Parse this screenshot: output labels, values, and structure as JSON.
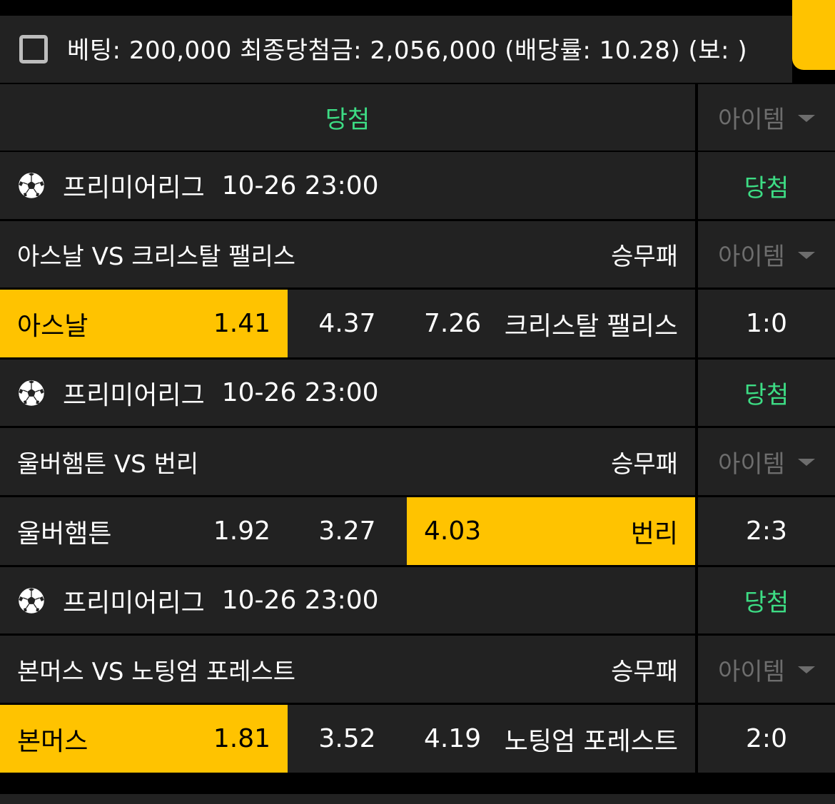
{
  "summary": {
    "text": "베팅: 200,000 최종당첨금: 2,056,000 (배당률: 10.28) (보: )"
  },
  "header": {
    "status": "당첨",
    "item_label": "아이템"
  },
  "matches": [
    {
      "league": "프리미어리그",
      "datetime": "10-26 23:00",
      "result_status": "당첨",
      "title": "아스날 VS 크리스탈 팰리스",
      "bet_type": "승무패",
      "item_label": "아이템",
      "home_team": "아스날",
      "home_odds": "1.41",
      "draw_odds": "4.37",
      "away_odds": "7.26",
      "away_team": "크리스탈 팰리스",
      "score": "1:0",
      "selected": "home"
    },
    {
      "league": "프리미어리그",
      "datetime": "10-26 23:00",
      "result_status": "당첨",
      "title": "울버햄튼 VS 번리",
      "bet_type": "승무패",
      "item_label": "아이템",
      "home_team": "울버햄튼",
      "home_odds": "1.92",
      "draw_odds": "3.27",
      "away_odds": "4.03",
      "away_team": "번리",
      "score": "2:3",
      "selected": "away"
    },
    {
      "league": "프리미어리그",
      "datetime": "10-26 23:00",
      "result_status": "당첨",
      "title": "본머스 VS 노팅엄 포레스트",
      "bet_type": "승무패",
      "item_label": "아이템",
      "home_team": "본머스",
      "home_odds": "1.81",
      "draw_odds": "3.52",
      "away_odds": "4.19",
      "away_team": "노팅엄 포레스트",
      "score": "2:0",
      "selected": "home"
    }
  ],
  "colors": {
    "accent": "#ffc300",
    "win": "#3ddc84",
    "panel": "#222222",
    "background": "#000000",
    "muted": "#6d6d6d"
  }
}
